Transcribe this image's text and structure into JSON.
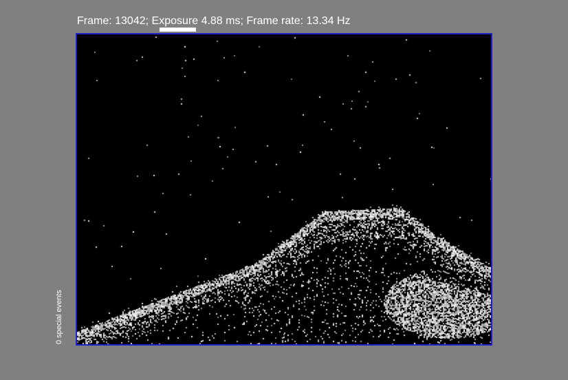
{
  "header": {
    "frame_label": "Frame:",
    "frame_number": "13042",
    "exposure_label": "Exposure",
    "exposure_value": "4.88 ms",
    "frame_rate_label": "Frame rate:",
    "frame_rate_value": "13.34 Hz"
  },
  "sidebar": {
    "special_events_text": "0 special events"
  },
  "colors": {
    "background": "#808080",
    "frame_border": "#2020c8",
    "text": "#ffffff",
    "image_background": "#000000"
  }
}
